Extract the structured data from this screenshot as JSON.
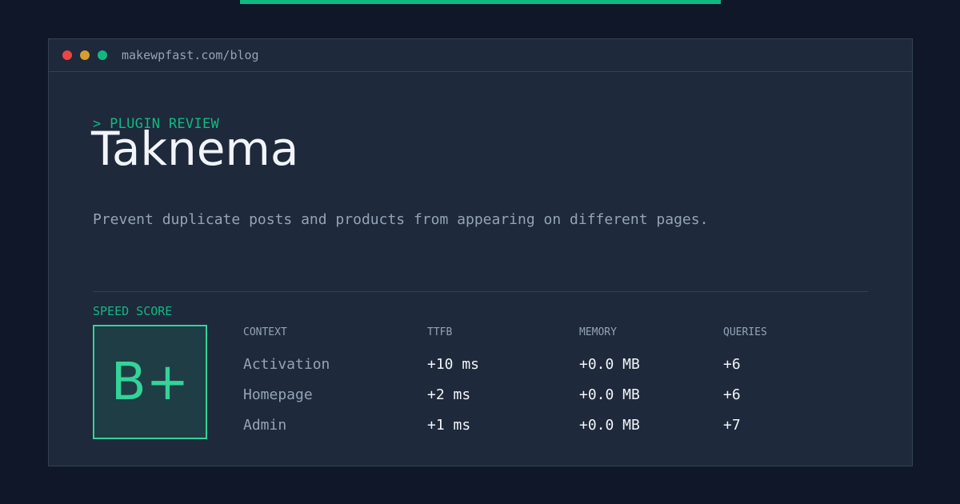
{
  "browser": {
    "url": "makewpfast.com/blog",
    "dots": {
      "red": "#ef4444",
      "yellow": "#eab308",
      "green": "#10b981"
    }
  },
  "review": {
    "eyebrow": "> PLUGIN REVIEW",
    "title": "Taknema",
    "description": "Prevent duplicate posts and products from appearing on different pages."
  },
  "speed": {
    "label": "SPEED SCORE",
    "grade": "B+"
  },
  "table": {
    "headers": {
      "context": "CONTEXT",
      "ttfb": "TTFB",
      "memory": "MEMORY",
      "queries": "QUERIES"
    },
    "rows": [
      {
        "context": "Activation",
        "ttfb": "+10 ms",
        "memory": "+0.0 MB",
        "queries": "+6"
      },
      {
        "context": "Homepage",
        "ttfb": "+2 ms",
        "memory": "+0.0 MB",
        "queries": "+6"
      },
      {
        "context": "Admin",
        "ttfb": "+1 ms",
        "memory": "+0.0 MB",
        "queries": "+7"
      }
    ]
  },
  "colors": {
    "background": "#0f1729",
    "panel": "#1e293b",
    "accent": "#10b981",
    "grade": "#34d399"
  }
}
